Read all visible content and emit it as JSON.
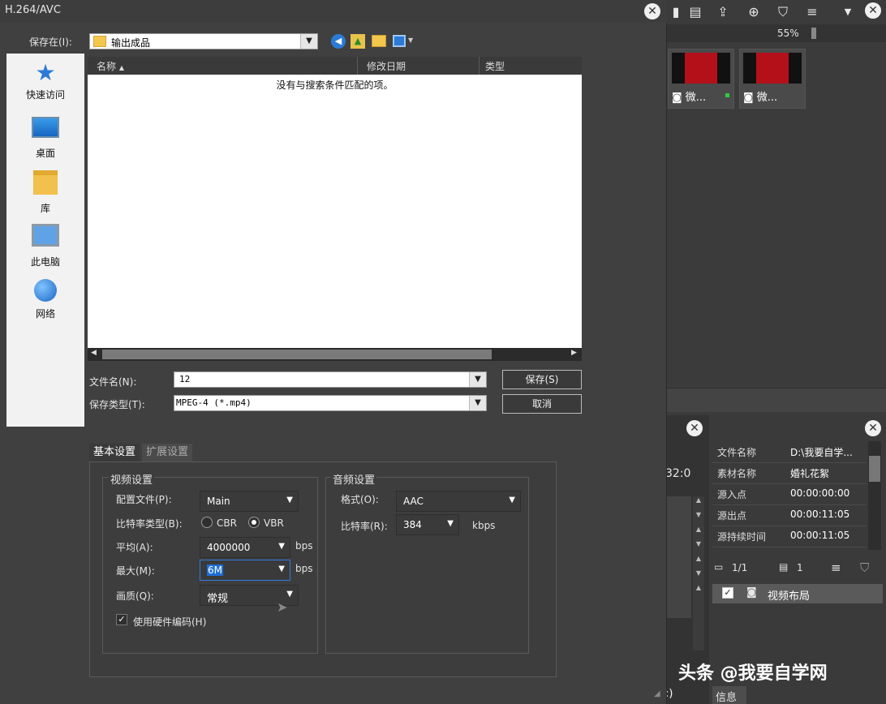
{
  "dialog": {
    "title": "H.264/AVC",
    "save_in_label": "保存在(I):",
    "save_in_value": "输出成品",
    "places": [
      {
        "label": "快速访问",
        "icon": "star-icon"
      },
      {
        "label": "桌面",
        "icon": "desktop-icon"
      },
      {
        "label": "库",
        "icon": "library-folder-icon"
      },
      {
        "label": "此电脑",
        "icon": "computer-icon"
      },
      {
        "label": "网络",
        "icon": "network-icon"
      }
    ],
    "columns": {
      "name": "名称",
      "date": "修改日期",
      "type": "类型"
    },
    "empty_message": "没有与搜索条件匹配的项。",
    "filename_label": "文件名(N):",
    "filename_value": "12",
    "filetype_label": "保存类型(T):",
    "filetype_value": "MPEG-4 (*.mp4)",
    "save_button": "保存(S)",
    "cancel_button": "取消"
  },
  "settings": {
    "tabs": [
      "基本设置",
      "扩展设置"
    ],
    "video": {
      "group_title": "视频设置",
      "profile_label": "配置文件(P):",
      "profile_value": "Main",
      "bitrate_type_label": "比特率类型(B):",
      "cbr_label": "CBR",
      "vbr_label": "VBR",
      "selected_bitrate_type": "VBR",
      "average_label": "平均(A):",
      "average_value": "4000000",
      "average_unit": "bps",
      "max_label": "最大(M):",
      "max_value": "6M",
      "max_unit": "bps",
      "quality_label": "画质(Q):",
      "quality_value": "常规",
      "hw_encode_label": "使用硬件编码(H)",
      "hw_encode_checked": true
    },
    "audio": {
      "group_title": "音频设置",
      "format_label": "格式(O):",
      "format_value": "AAC",
      "bitrate_label": "比特率(R):",
      "bitrate_value": "384",
      "bitrate_unit": "kbps"
    }
  },
  "background_app": {
    "zoom": "55%",
    "thumbnails": [
      {
        "caption": "微..."
      },
      {
        "caption": "微..."
      }
    ],
    "partial_time": "32:0",
    "properties": [
      {
        "key": "文件名称",
        "value": "D:\\我要自学..."
      },
      {
        "key": "素材名称",
        "value": "婚礼花絮"
      },
      {
        "key": "源入点",
        "value": "00:00:00:00"
      },
      {
        "key": "源出点",
        "value": "00:00:11:05"
      },
      {
        "key": "源持续时间",
        "value": "00:00:11:05"
      }
    ],
    "page_indicator": "1/1",
    "count": "1",
    "layer_label": "视频布局",
    "bottom_tab": "信息",
    "partial_bottom": ":)"
  },
  "watermark": "头条 @我要自学网",
  "colors": {
    "dialog_bg": "#404040",
    "list_bg": "#ffffff",
    "accent_red": "#b3101a",
    "selection_blue": "#1e6fd9"
  }
}
